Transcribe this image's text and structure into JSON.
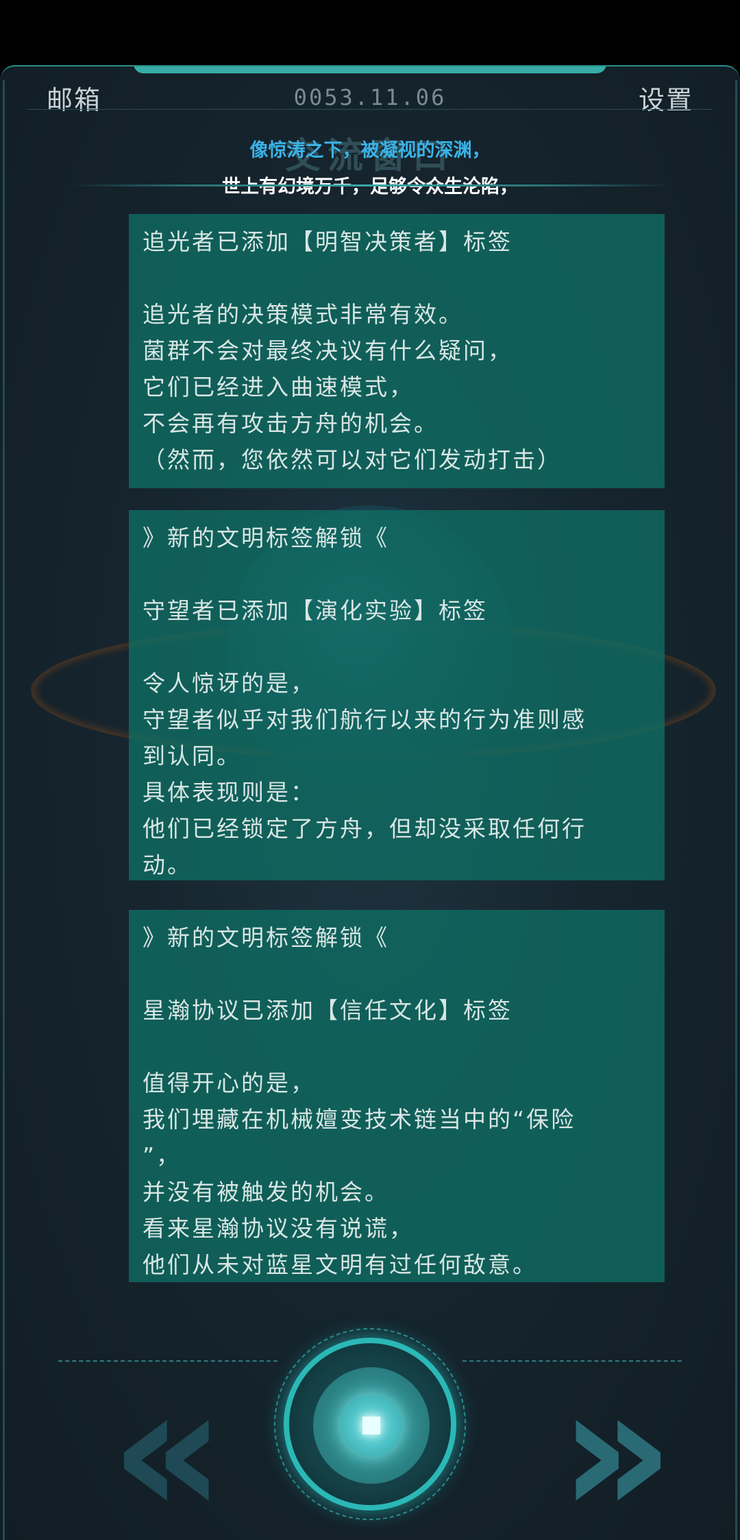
{
  "header": {
    "mailbox_label": "邮箱",
    "date": "0053.11.06",
    "settings_label": "设置",
    "bg_title": "交流窗口"
  },
  "lyrics": {
    "line1": "像惊涛之下，被凝视的深渊，",
    "line2": "世上有幻境万千，足够令众生沦陷，"
  },
  "messages": [
    {
      "lines": [
        "追光者已添加【明智决策者】标签",
        "",
        "追光者的决策模式非常有效。",
        "菌群不会对最终决议有什么疑问，",
        "它们已经进入曲速模式，",
        "不会再有攻击方舟的机会。",
        "（然而，您依然可以对它们发动打击）"
      ]
    },
    {
      "lines": [
        "》新的文明标签解锁《",
        "",
        "守望者已添加【演化实验】标签",
        "",
        "令人惊讶的是，",
        "守望者似乎对我们航行以来的行为准则感",
        "到认同。",
        "具体表现则是：",
        "他们已经锁定了方舟，但却没采取任何行",
        "动。"
      ]
    },
    {
      "lines": [
        "》新的文明标签解锁《",
        "",
        "星瀚协议已添加【信任文化】标签",
        "",
        "值得开心的是，",
        "我们埋藏在机械嬗变技术链当中的“保险",
        "”，",
        "并没有被触发的机会。",
        "看来星瀚协议没有说谎，",
        "他们从未对蓝星文明有过任何敌意。"
      ]
    }
  ],
  "nav": {
    "prev_glyph": "«",
    "next_glyph": "»"
  },
  "colors": {
    "card_bg": "#0f6e64",
    "accent": "#2bb8b6",
    "lyric_blue": "#3ab3e8"
  }
}
